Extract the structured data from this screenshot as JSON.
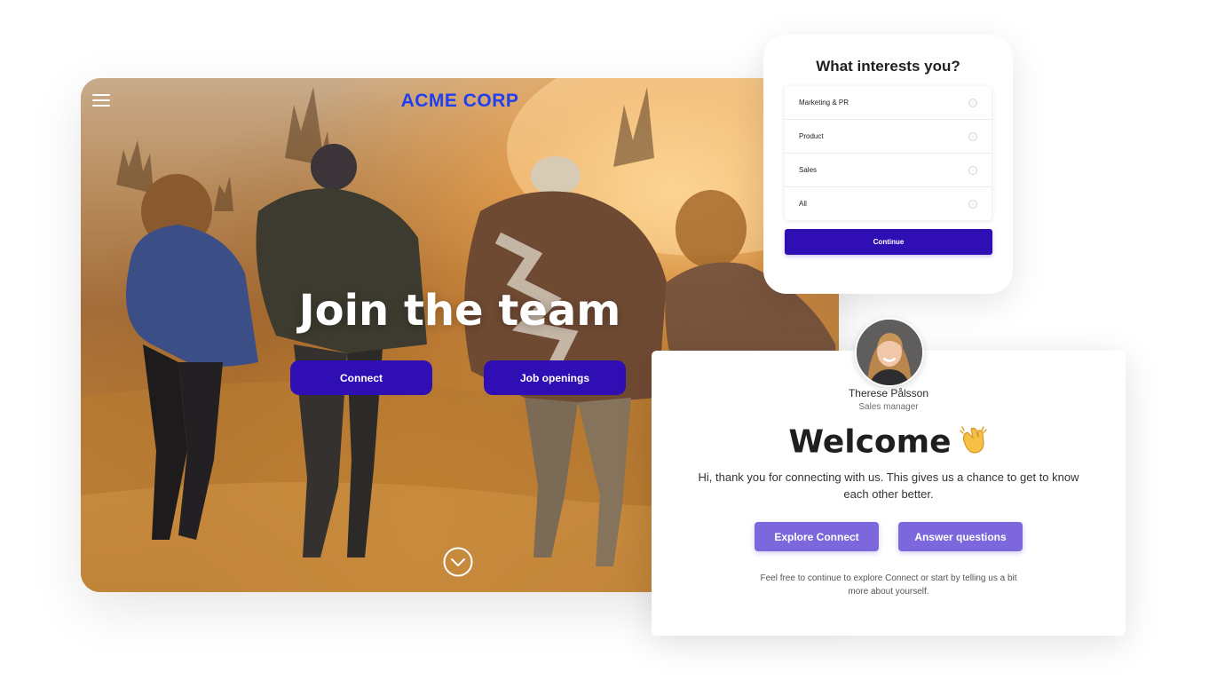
{
  "theme": {
    "brand_color": "#1f3ff0",
    "primary_color": "#2f0fb4",
    "soft_button_color": "#7c67dc"
  },
  "hero": {
    "logo": "ACME CORP",
    "headline": "Join the team",
    "connect_label": "Connect",
    "jobs_label": "Job openings",
    "menu_icon": "hamburger-menu-icon",
    "scroll_icon": "chevron-down-circle-icon"
  },
  "interests": {
    "title": "What interests you?",
    "options": [
      {
        "label": "Marketing & PR"
      },
      {
        "label": "Product"
      },
      {
        "label": "Sales"
      },
      {
        "label": "All"
      }
    ],
    "continue_label": "Continue"
  },
  "welcome": {
    "person_name": "Therese Pålsson",
    "person_role": "Sales manager",
    "heading": "Welcome",
    "heading_icon": "clapping-hands-icon",
    "intro": "Hi, thank you for connecting with us. This gives us a chance to get to know each other better.",
    "explore_label": "Explore Connect",
    "answer_label": "Answer questions",
    "footnote": "Feel free to continue to explore Connect or start by telling us a bit more about yourself."
  }
}
